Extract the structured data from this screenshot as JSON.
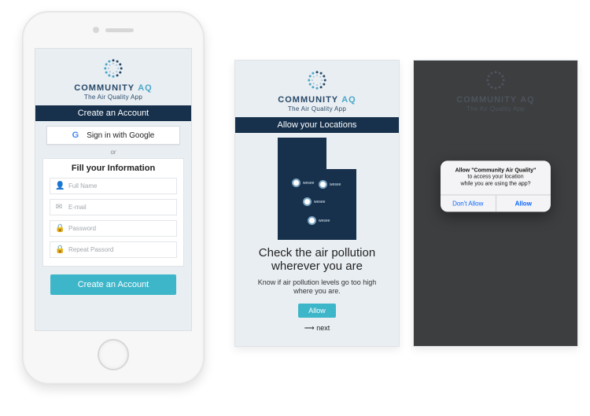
{
  "brand": {
    "name_part1": "COMMUNITY",
    "name_part2": "AQ",
    "tagline": "The Air Quality App"
  },
  "screen1": {
    "header": "Create an Account",
    "google_button": "Sign in with Google",
    "or": "or",
    "form_title": "Fill your Information",
    "fields": {
      "name": {
        "placeholder": "Full Name"
      },
      "email": {
        "placeholder": "E-mail"
      },
      "pass": {
        "placeholder": "Password"
      },
      "repeat": {
        "placeholder": "Repeat Passord"
      }
    },
    "submit": "Create an Account"
  },
  "screen2": {
    "header": "Allow your Locations",
    "pins": [
      "wesee",
      "wesee",
      "wesee",
      "wesee"
    ],
    "headline": "Check the air pollution wherever you are",
    "sub": "Know if air pollution  levels go too high where you are.",
    "allow": "Allow",
    "next": "next"
  },
  "screen3": {
    "alert": {
      "line1": "Allow \"Community Air Quality\"",
      "line2": "to access your location",
      "line3": "while you are using the app?",
      "dont": "Don't Allow",
      "allow": "Allow"
    }
  }
}
